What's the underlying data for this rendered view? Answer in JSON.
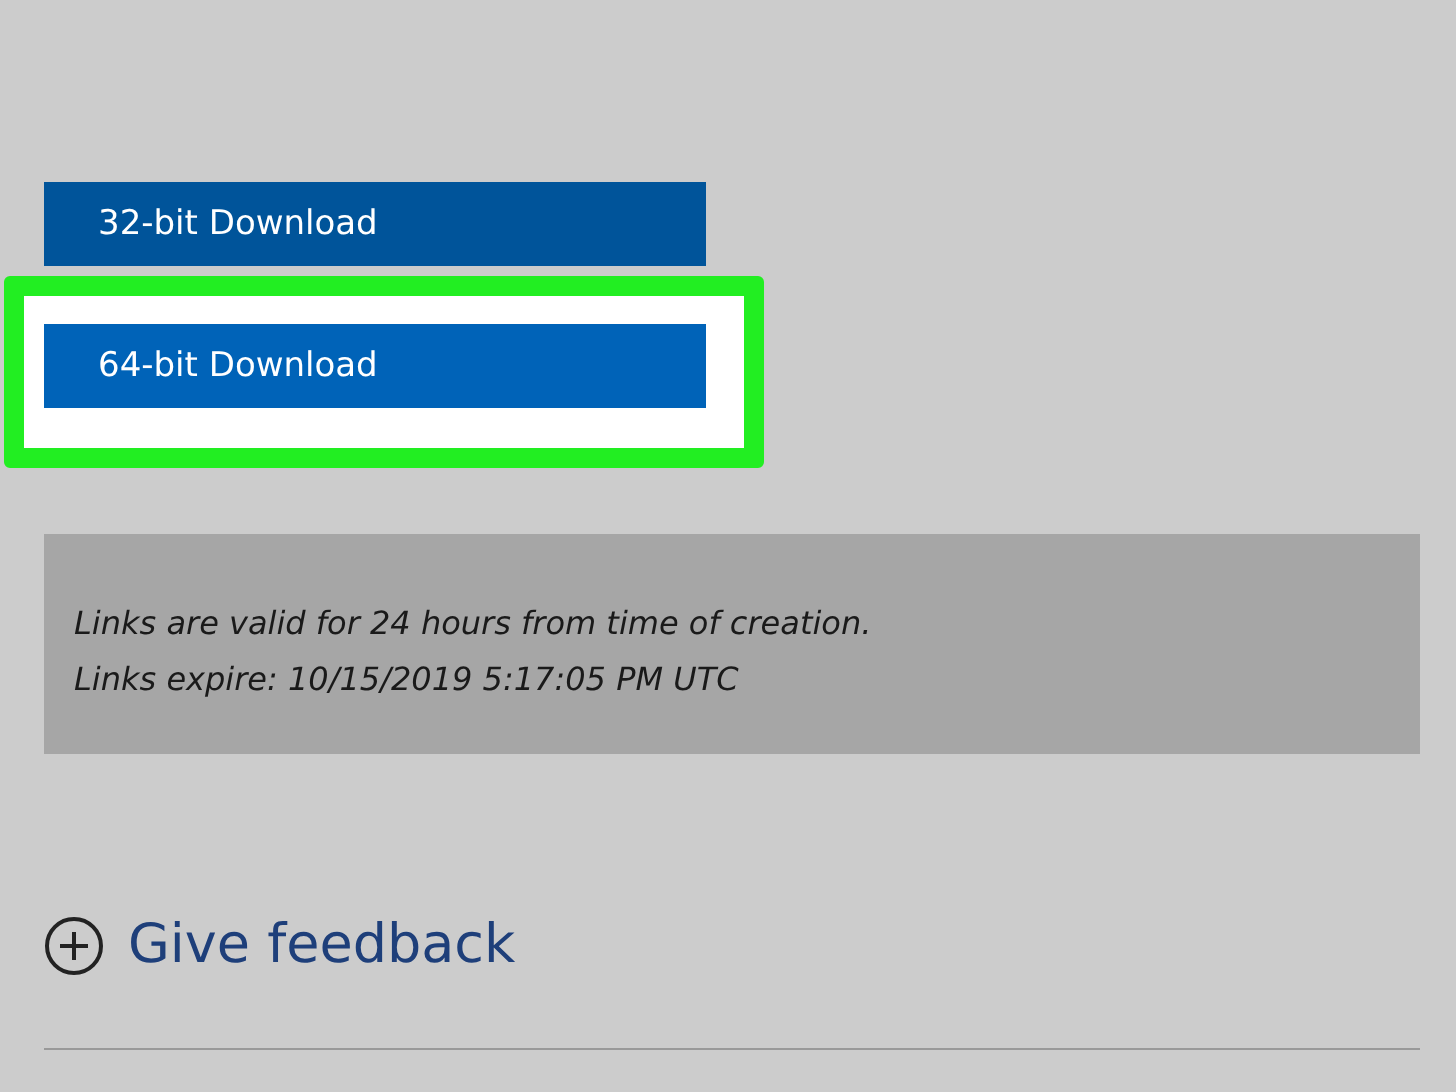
{
  "downloads": [
    {
      "label": "32-bit Download",
      "highlighted": false
    },
    {
      "label": "64-bit Download",
      "highlighted": true
    }
  ],
  "notice": {
    "lines": [
      "Links are valid for 24 hours from time of creation.",
      "Links expire: 10/15/2019 5:17:05 PM UTC"
    ]
  },
  "feedback": {
    "label": "Give feedback"
  }
}
